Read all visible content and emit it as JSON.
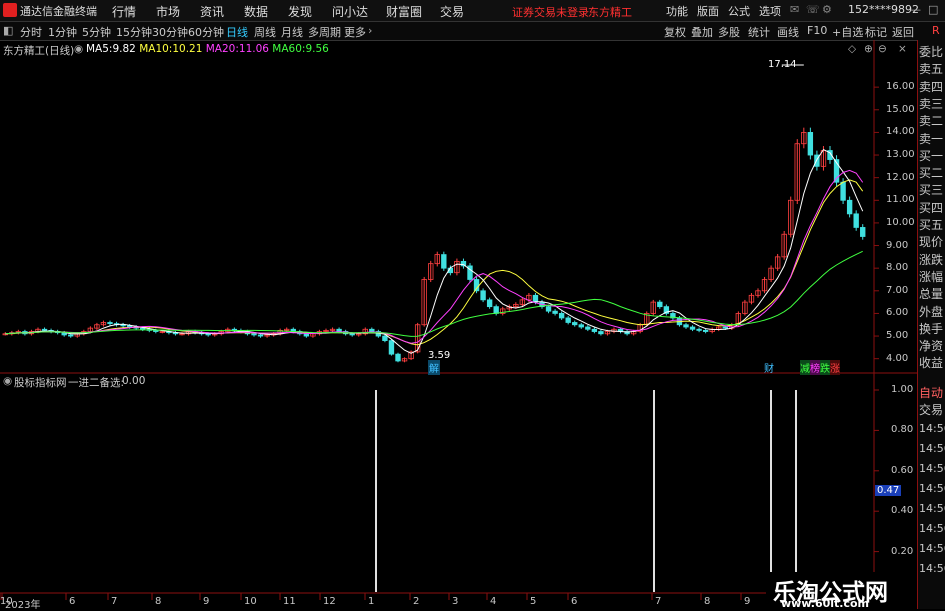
{
  "app": {
    "title": "通达信金融终端",
    "menu": [
      "行情",
      "市场",
      "资讯",
      "数据",
      "发现",
      "问小达",
      "财富圈",
      "交易"
    ],
    "notice": "证券交易未登录",
    "stock_name_top": "东方精工",
    "right_menu": [
      "功能",
      "版面",
      "公式",
      "选项"
    ],
    "user": "152****9892"
  },
  "periods": [
    "分时",
    "1分钟",
    "5分钟",
    "15分钟",
    "30分钟",
    "60分钟",
    "日线",
    "周线",
    "月线",
    "多周期",
    "更多"
  ],
  "active_period": "日线",
  "toolbar_right": [
    "复权",
    "叠加",
    "多股",
    "统计",
    "画线",
    "F10",
    "+自选",
    "标记",
    "返回"
  ],
  "price_panel": {
    "stock": "东方精工(日线)",
    "ma": [
      {
        "label": "MA5:",
        "value": "9.82",
        "color": "#ffffff"
      },
      {
        "label": "MA10:",
        "value": "10.21",
        "color": "#ffff40"
      },
      {
        "label": "MA20:",
        "value": "11.06",
        "color": "#ff40ff"
      },
      {
        "label": "MA60:",
        "value": "9.56",
        "color": "#40ff40"
      }
    ],
    "high_mark": "17.14",
    "low_mark": "3.59",
    "badges": [
      {
        "text": "解",
        "color": "#40c0ff"
      },
      {
        "text": "财",
        "color": "#40c0ff"
      },
      {
        "text": "减",
        "color": "#40ff40"
      },
      {
        "text": "榜",
        "color": "#ff40ff"
      },
      {
        "text": "跌",
        "color": "#40ff40"
      },
      {
        "text": "涨",
        "color": "#ff4040"
      }
    ],
    "y_ticks": [
      "16.00",
      "15.00",
      "14.00",
      "13.00",
      "12.00",
      "11.00",
      "10.00",
      "9.00",
      "8.00",
      "7.00",
      "6.00",
      "5.00",
      "4.00"
    ]
  },
  "indicator_panel": {
    "name": "股标指标网",
    "label": "一进二备选:",
    "value": "0.00",
    "y_ticks": [
      "1.00",
      "0.80",
      "0.60",
      "0.40",
      "0.20"
    ],
    "cursor_value": "0.47"
  },
  "x_axis": [
    "2023年",
    "6",
    "7",
    "8",
    "9",
    "10",
    "11",
    "12",
    "1",
    "2",
    "3",
    "4",
    "5",
    "6",
    "7",
    "8",
    "9",
    "10"
  ],
  "side_labels": [
    "委比",
    "卖五",
    "卖四",
    "卖三",
    "卖二",
    "卖一",
    "买一",
    "买二",
    "买三",
    "买四",
    "买五",
    "现价",
    "涨跌",
    "涨幅",
    "总量",
    "外盘",
    "换手",
    "净资",
    "收益"
  ],
  "side_lower": [
    "自动",
    "交易"
  ],
  "side_times": [
    "14:56",
    "14:56",
    "14:56",
    "14:56",
    "14:56",
    "14:56",
    "14:56",
    "14:56"
  ],
  "watermark": {
    "cn": "乐淘公式网",
    "url": "www.60lt.com"
  },
  "chart_data": {
    "type": "line",
    "price_close": [
      5.1,
      5.15,
      5.2,
      5.1,
      5.2,
      5.3,
      5.25,
      5.2,
      5.15,
      5.05,
      5.0,
      5.1,
      5.2,
      5.35,
      5.5,
      5.6,
      5.55,
      5.5,
      5.45,
      5.4,
      5.35,
      5.3,
      5.25,
      5.2,
      5.2,
      5.15,
      5.1,
      5.1,
      5.2,
      5.15,
      5.1,
      5.05,
      5.1,
      5.2,
      5.3,
      5.25,
      5.2,
      5.1,
      5.05,
      5.0,
      5.05,
      5.1,
      5.25,
      5.3,
      5.2,
      5.1,
      5.0,
      5.1,
      5.2,
      5.25,
      5.3,
      5.2,
      5.1,
      5.05,
      5.1,
      5.3,
      5.2,
      5.0,
      4.8,
      4.2,
      3.9,
      4.0,
      4.3,
      5.5,
      7.5,
      8.2,
      8.6,
      8.0,
      7.8,
      8.3,
      8.1,
      7.5,
      7.0,
      6.6,
      6.3,
      6.0,
      6.2,
      6.3,
      6.4,
      6.6,
      6.8,
      6.5,
      6.3,
      6.1,
      6.0,
      5.8,
      5.6,
      5.5,
      5.4,
      5.3,
      5.2,
      5.1,
      5.2,
      5.3,
      5.2,
      5.1,
      5.2,
      5.5,
      6.0,
      6.5,
      6.3,
      6.0,
      5.8,
      5.5,
      5.4,
      5.3,
      5.25,
      5.2,
      5.3,
      5.4,
      5.35,
      5.5,
      6.0,
      6.5,
      6.8,
      7.0,
      7.5,
      8.0,
      8.5,
      9.5,
      11.0,
      13.5,
      14.0,
      13.0,
      12.5,
      13.2,
      12.8,
      11.8,
      11.0,
      10.4,
      9.8,
      9.4
    ],
    "ma5": [
      5.1,
      5.12,
      5.15,
      5.15,
      5.16,
      5.2,
      5.22,
      5.22,
      5.2,
      5.16,
      5.1,
      5.09,
      5.1,
      5.15,
      5.23,
      5.35,
      5.45,
      5.51,
      5.52,
      5.48,
      5.43,
      5.38,
      5.33,
      5.28,
      5.24,
      5.2,
      5.16,
      5.13,
      5.13,
      5.13,
      5.13,
      5.12,
      5.1,
      5.12,
      5.15,
      5.18,
      5.21,
      5.2,
      5.16,
      5.11,
      5.08,
      5.06,
      5.09,
      5.14,
      5.18,
      5.19,
      5.17,
      5.14,
      5.12,
      5.13,
      5.17,
      5.17,
      5.17,
      5.14,
      5.12,
      5.15,
      5.15,
      5.13,
      5.08,
      4.86,
      4.62,
      4.38,
      4.24,
      4.38,
      5.02,
      5.88,
      6.82,
      7.56,
      8.02,
      8.18,
      8.16,
      7.94,
      7.74,
      7.48,
      7.1,
      6.68,
      6.42,
      6.28,
      6.24,
      6.3,
      6.46,
      6.52,
      6.52,
      6.46,
      6.34,
      6.14,
      5.96,
      5.8,
      5.66,
      5.52,
      5.4,
      5.3,
      5.24,
      5.22,
      5.2,
      5.18,
      5.2,
      5.26,
      5.44,
      5.72,
      5.9,
      6.06,
      6.12,
      6.02,
      5.8,
      5.6,
      5.45,
      5.33,
      5.29,
      5.29,
      5.3,
      5.35,
      5.51,
      5.75,
      6.03,
      6.36,
      6.76,
      7.16,
      7.56,
      8.1,
      8.9,
      10.1,
      11.3,
      12.2,
      12.8,
      13.24,
      13.1,
      12.66,
      12.26,
      11.84,
      11.16,
      10.52
    ],
    "ma10": [
      5.1,
      5.11,
      5.13,
      5.14,
      5.15,
      5.17,
      5.19,
      5.19,
      5.19,
      5.18,
      5.15,
      5.14,
      5.15,
      5.17,
      5.2,
      5.25,
      5.3,
      5.34,
      5.37,
      5.38,
      5.39,
      5.39,
      5.4,
      5.38,
      5.35,
      5.31,
      5.27,
      5.23,
      5.2,
      5.18,
      5.16,
      5.14,
      5.13,
      5.13,
      5.14,
      5.15,
      5.15,
      5.15,
      5.14,
      5.13,
      5.12,
      5.12,
      5.13,
      5.15,
      5.16,
      5.15,
      5.14,
      5.13,
      5.13,
      5.14,
      5.15,
      5.15,
      5.14,
      5.13,
      5.13,
      5.14,
      5.14,
      5.13,
      5.1,
      5.0,
      4.89,
      4.77,
      4.66,
      4.61,
      4.71,
      4.86,
      5.07,
      5.3,
      5.55,
      5.85,
      6.24,
      6.68,
      7.1,
      7.45,
      7.74,
      7.86,
      7.9,
      7.85,
      7.72,
      7.5,
      7.22,
      6.97,
      6.78,
      6.64,
      6.6,
      6.54,
      6.45,
      6.33,
      6.21,
      6.1,
      6.0,
      5.9,
      5.82,
      5.75,
      5.68,
      5.6,
      5.54,
      5.5,
      5.52,
      5.56,
      5.6,
      5.6,
      5.62,
      5.64,
      5.66,
      5.65,
      5.62,
      5.56,
      5.5,
      5.46,
      5.45,
      5.48,
      5.56,
      5.68,
      5.84,
      6.0,
      6.2,
      6.45,
      6.74,
      7.1,
      7.6,
      8.3,
      9.0,
      9.7,
      10.3,
      10.9,
      11.3,
      11.6,
      11.8,
      11.9,
      11.8,
      11.4
    ]
  }
}
